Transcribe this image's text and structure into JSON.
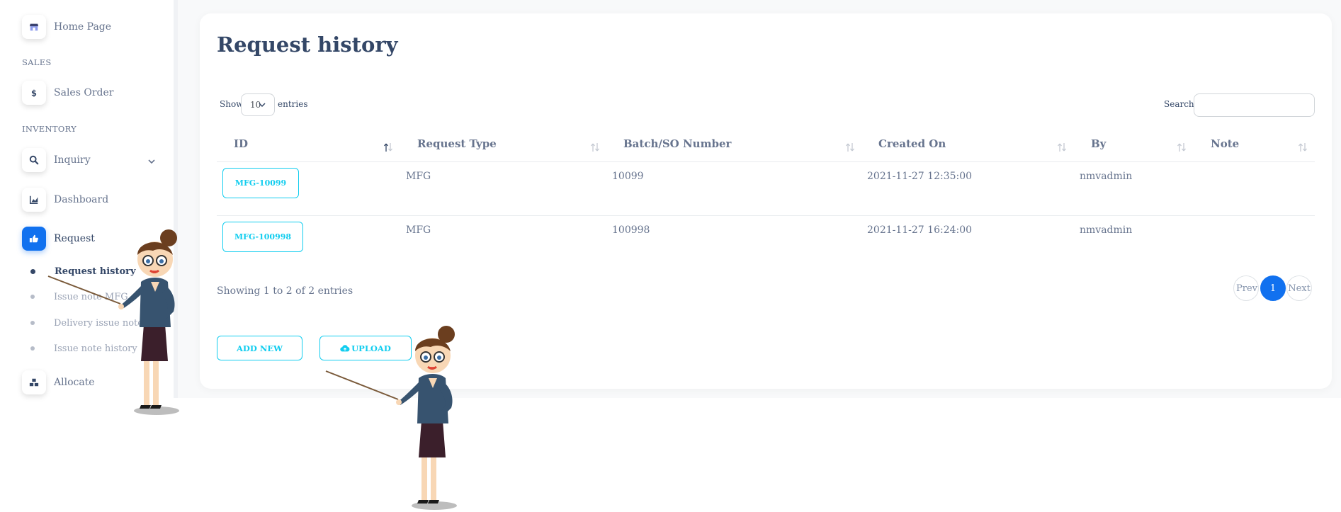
{
  "sidebar": {
    "home": "Home Page",
    "sales_section": "SALES",
    "sales_order": "Sales Order",
    "inventory_section": "INVENTORY",
    "inquiry": "Inquiry",
    "dashboard": "Dashboard",
    "request": "Request",
    "sub_items": [
      "Request history",
      "Issue note MFG",
      "Delivery issue notes",
      "Issue note history"
    ],
    "allocate": "Allocate"
  },
  "page": {
    "title": "Request history",
    "show_label": "Show",
    "entries_value": "10",
    "entries_label": "entries",
    "search_label": "Search:",
    "search_value": ""
  },
  "table": {
    "headers": [
      "ID",
      "Request Type",
      "Batch/SO Number",
      "Created On",
      "By",
      "Note"
    ],
    "rows": [
      {
        "id": "MFG-10099",
        "type": "MFG",
        "batch": "10099",
        "created": "2021-11-27 12:35:00",
        "by": "nmvadmin",
        "note": ""
      },
      {
        "id": "MFG-100998",
        "type": "MFG",
        "batch": "100998",
        "created": "2021-11-27 16:24:00",
        "by": "nmvadmin",
        "note": ""
      }
    ]
  },
  "footer": {
    "showing": "Showing 1 to 2 of 2 entries",
    "previous": "Previous",
    "page": "1",
    "next": "Next"
  },
  "actions": {
    "add_new": "ADD NEW",
    "upload": "UPLOAD"
  },
  "colors": {
    "accent": "#11cdef",
    "primary": "#1171ef",
    "text": "#344767",
    "muted": "#67748e"
  },
  "icons": [
    "store-icon",
    "dollar-icon",
    "search-icon",
    "chart-area-icon",
    "thumbs-up-icon",
    "boxes-icon",
    "chevron-down-icon",
    "sort-icon",
    "cloud-upload-icon"
  ]
}
